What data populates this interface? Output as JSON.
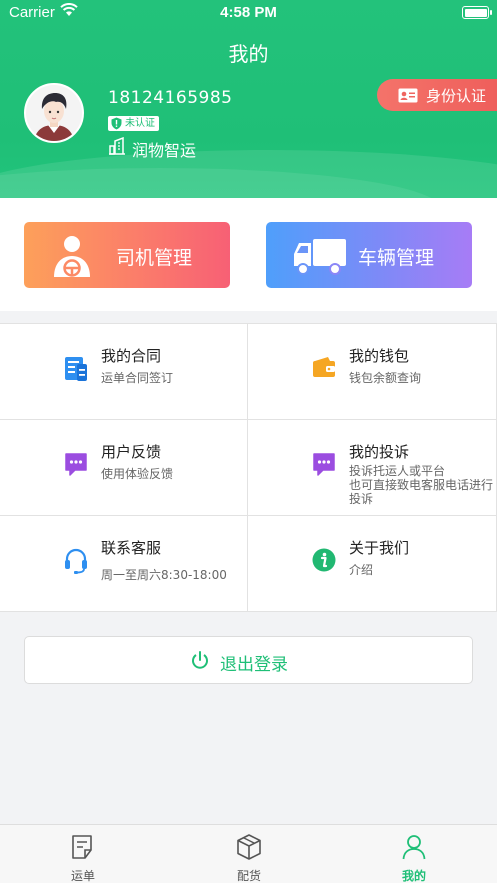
{
  "status_bar": {
    "carrier": "Carrier",
    "time": "4:58 PM"
  },
  "header": {
    "title": "我的",
    "phone": "18124165985",
    "verify_status": "未认证",
    "company": "润物智运",
    "verify_button": "身份认证",
    "brand_color": "#1fbf77"
  },
  "cards": [
    {
      "label": "司机管理",
      "icon": "steering-wheel-driver-icon"
    },
    {
      "label": "车辆管理",
      "icon": "truck-icon"
    }
  ],
  "grid": [
    {
      "title": "我的合同",
      "subtitle": "运单合同签订",
      "icon": "contract-icon"
    },
    {
      "title": "我的钱包",
      "subtitle": "钱包余额查询",
      "icon": "wallet-icon"
    },
    {
      "title": "用户反馈",
      "subtitle": "使用体验反馈",
      "icon": "chat-icon"
    },
    {
      "title": "我的投诉",
      "subtitle": "投诉托运人或平台\n也可直接致电客服电话进行投诉",
      "icon": "chat-icon"
    },
    {
      "title": "联系客服",
      "subtitle": "周一至周六8:30-18:00",
      "icon": "headset-icon"
    },
    {
      "title": "关于我们",
      "subtitle": "介绍",
      "icon": "info-icon"
    }
  ],
  "logout_label": "退出登录",
  "tabbar": {
    "items": [
      {
        "label": "运单",
        "icon": "document-icon"
      },
      {
        "label": "配货",
        "icon": "box-icon"
      },
      {
        "label": "我的",
        "icon": "person-icon"
      }
    ],
    "active": "我的"
  }
}
